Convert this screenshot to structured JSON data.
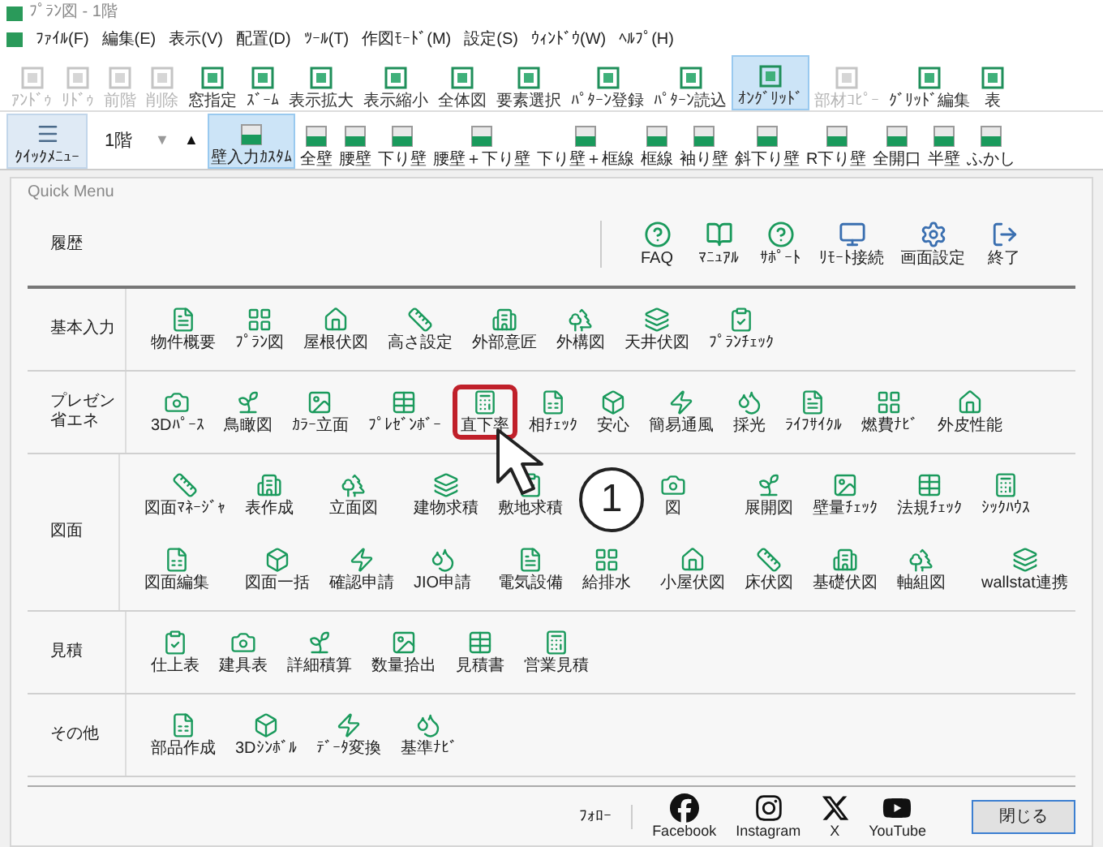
{
  "window": {
    "title": "ﾌﾟﾗﾝ図 - 1階"
  },
  "menu": [
    "ﾌｧｲﾙ(F)",
    "編集(E)",
    "表示(V)",
    "配置(D)",
    "ﾂｰﾙ(T)",
    "作図ﾓｰﾄﾞ(M)",
    "設定(S)",
    "ｳｨﾝﾄﾞｳ(W)",
    "ﾍﾙﾌﾟ(H)"
  ],
  "toolbar": [
    {
      "label": "ｱﾝﾄﾞｩ",
      "disabled": true,
      "selected": false
    },
    {
      "label": "ﾘﾄﾞｩ",
      "disabled": true,
      "selected": false
    },
    {
      "label": "前階",
      "disabled": true,
      "selected": false
    },
    {
      "label": "削除",
      "disabled": true,
      "selected": false
    },
    {
      "label": "窓指定",
      "disabled": false,
      "selected": false
    },
    {
      "label": "ｽﾞｰﾑ",
      "disabled": false,
      "selected": false
    },
    {
      "label": "表示拡大",
      "disabled": false,
      "selected": false
    },
    {
      "label": "表示縮小",
      "disabled": false,
      "selected": false
    },
    {
      "label": "全体図",
      "disabled": false,
      "selected": false
    },
    {
      "label": "要素選択",
      "disabled": false,
      "selected": false
    },
    {
      "label": "ﾊﾟﾀｰﾝ登録",
      "disabled": false,
      "selected": false
    },
    {
      "label": "ﾊﾟﾀｰﾝ読込",
      "disabled": false,
      "selected": false
    },
    {
      "label": "ｵﾝｸﾞﾘｯﾄﾞ",
      "disabled": false,
      "selected": true
    },
    {
      "label": "部材ｺﾋﾟｰ",
      "disabled": true,
      "selected": false
    },
    {
      "label": "ｸﾞﾘｯﾄﾞ編集",
      "disabled": false,
      "selected": false
    },
    {
      "label": "表",
      "disabled": false,
      "selected": false
    }
  ],
  "wall_bar": {
    "quick_menu": "ｸｲｯｸﾒﾆｭｰ",
    "floor": "1階",
    "floor_buttons": [
      "▼",
      "▲"
    ],
    "tools": [
      {
        "label": "壁入力ｶｽﾀﾑ",
        "selected": true
      },
      {
        "label": "全壁",
        "selected": false
      },
      {
        "label": "腰壁",
        "selected": false
      },
      {
        "label": "下り壁",
        "selected": false
      },
      {
        "label": "腰壁＋下り壁",
        "selected": false
      },
      {
        "label": "下り壁＋框線",
        "selected": false
      },
      {
        "label": "框線",
        "selected": false
      },
      {
        "label": "袖り壁",
        "selected": false
      },
      {
        "label": "斜下り壁",
        "selected": false
      },
      {
        "label": "R下り壁",
        "selected": false
      },
      {
        "label": "全開口",
        "selected": false
      },
      {
        "label": "半壁",
        "selected": false
      },
      {
        "label": "ふかし",
        "selected": false
      }
    ]
  },
  "quick_menu": {
    "title": "Quick Menu",
    "history": "履歴",
    "help_items": [
      "FAQ",
      "ﾏﾆｭｱﾙ",
      "ｻﾎﾟｰﾄ",
      "ﾘﾓｰﾄ接続",
      "画面設定",
      "終了"
    ],
    "sections": [
      {
        "label": "基本入力",
        "rows": [
          [
            {
              "label": "物件概要",
              "highlighted": false
            },
            {
              "label": "ﾌﾟﾗﾝ図",
              "highlighted": false
            },
            {
              "label": "屋根伏図",
              "highlighted": false
            },
            {
              "label": "高さ設定",
              "highlighted": false
            },
            {
              "label": "外部意匠",
              "highlighted": false
            },
            {
              "label": "外構図",
              "highlighted": false
            },
            {
              "label": "天井伏図",
              "highlighted": false
            },
            {
              "label": "ﾌﾟﾗﾝﾁｪｯｸ",
              "highlighted": false
            }
          ]
        ]
      },
      {
        "label": "プレゼン省エネ",
        "rows": [
          [
            {
              "label": "3Dﾊﾟｰｽ",
              "highlighted": false
            },
            {
              "label": "鳥瞰図",
              "highlighted": false
            },
            {
              "label": "ｶﾗｰ立面",
              "highlighted": false
            },
            {
              "label": "ﾌﾟﾚｾﾞﾝﾎﾞｰ",
              "highlighted": false
            },
            {
              "label": "直下率",
              "highlighted": true
            },
            {
              "label": "相ﾁｪｯｸ",
              "highlighted": false
            },
            {
              "label": "安心",
              "highlighted": false
            },
            {
              "label": "簡易通風",
              "highlighted": false
            },
            {
              "label": "採光",
              "highlighted": false
            },
            {
              "label": "ﾗｲﾌｻｲｸﾙ",
              "highlighted": false
            },
            {
              "label": "燃費ﾅﾋﾞ",
              "highlighted": false
            },
            {
              "label": "外皮性能",
              "highlighted": false
            }
          ]
        ]
      },
      {
        "label": "図面",
        "rows": [
          [
            {
              "label": "図面ﾏﾈｰｼﾞｬ",
              "highlighted": false
            },
            {
              "label": "表作成",
              "highlighted": false
            },
            {
              "label": "立面図",
              "highlighted": false
            },
            {
              "label": "建物求積",
              "highlighted": false
            },
            {
              "label": "敷地求積",
              "highlighted": false
            },
            {
              "kind": "callout"
            },
            {
              "label": "図",
              "highlighted": false
            },
            {
              "label": "展開図",
              "highlighted": false
            },
            {
              "label": "壁量ﾁｪｯｸ",
              "highlighted": false
            },
            {
              "label": "法規ﾁｪｯｸ",
              "highlighted": false
            },
            {
              "label": "ｼｯｸﾊｳｽ",
              "highlighted": false
            }
          ],
          [
            {
              "label": "図面編集",
              "highlighted": false
            },
            {
              "label": "図面一括",
              "highlighted": false
            },
            {
              "label": "確認申請",
              "highlighted": false
            },
            {
              "label": "JIO申請",
              "highlighted": false
            },
            {
              "label": "電気設備",
              "highlighted": false
            },
            {
              "label": "給排水",
              "highlighted": false
            },
            {
              "label": "小屋伏図",
              "highlighted": false
            },
            {
              "label": "床伏図",
              "highlighted": false
            },
            {
              "label": "基礎伏図",
              "highlighted": false
            },
            {
              "label": "軸組図",
              "highlighted": false
            },
            {
              "label": "wallstat連携",
              "highlighted": false
            }
          ]
        ]
      },
      {
        "label": "見積",
        "rows": [
          [
            {
              "label": "仕上表",
              "highlighted": false
            },
            {
              "label": "建具表",
              "highlighted": false
            },
            {
              "label": "詳細積算",
              "highlighted": false
            },
            {
              "label": "数量拾出",
              "highlighted": false
            },
            {
              "label": "見積書",
              "highlighted": false
            },
            {
              "label": "営業見積",
              "highlighted": false
            }
          ]
        ]
      },
      {
        "label": "その他",
        "rows": [
          [
            {
              "label": "部品作成",
              "highlighted": false
            },
            {
              "label": "3Dｼﾝﾎﾞﾙ",
              "highlighted": false
            },
            {
              "label": "ﾃﾞｰﾀ変換",
              "highlighted": false
            },
            {
              "label": "基準ﾅﾋﾞ",
              "highlighted": false
            }
          ]
        ]
      }
    ],
    "follow": "ﾌｫﾛｰ",
    "social": [
      {
        "kind": "facebook",
        "label": "Facebook"
      },
      {
        "kind": "instagram",
        "label": "Instagram"
      },
      {
        "kind": "x",
        "label": "X"
      },
      {
        "kind": "youtube",
        "label": "YouTube"
      }
    ],
    "close_button": "閉じる"
  },
  "callout": {
    "number": "1"
  }
}
